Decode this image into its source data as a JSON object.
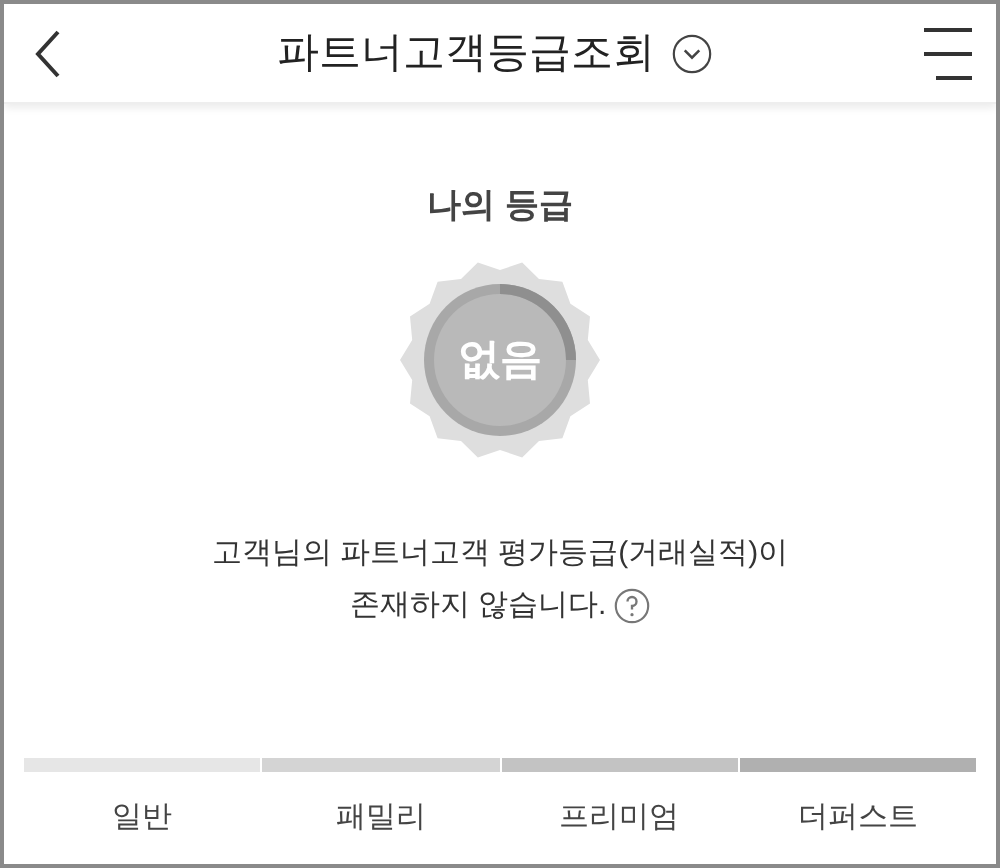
{
  "header": {
    "title": "파트너고객등급조회"
  },
  "grade": {
    "heading": "나의 등급",
    "value": "없음"
  },
  "message": {
    "line_1": "고객님의 파트너고객 평가등급(거래실적)이",
    "line_2": "존재하지 않습니다."
  },
  "levels": [
    {
      "label": "일반",
      "color": "#e6e6e6"
    },
    {
      "label": "패밀리",
      "color": "#d4d4d4"
    },
    {
      "label": "프리미엄",
      "color": "#c3c3c3"
    },
    {
      "label": "더퍼스트",
      "color": "#b0b0b0"
    }
  ]
}
